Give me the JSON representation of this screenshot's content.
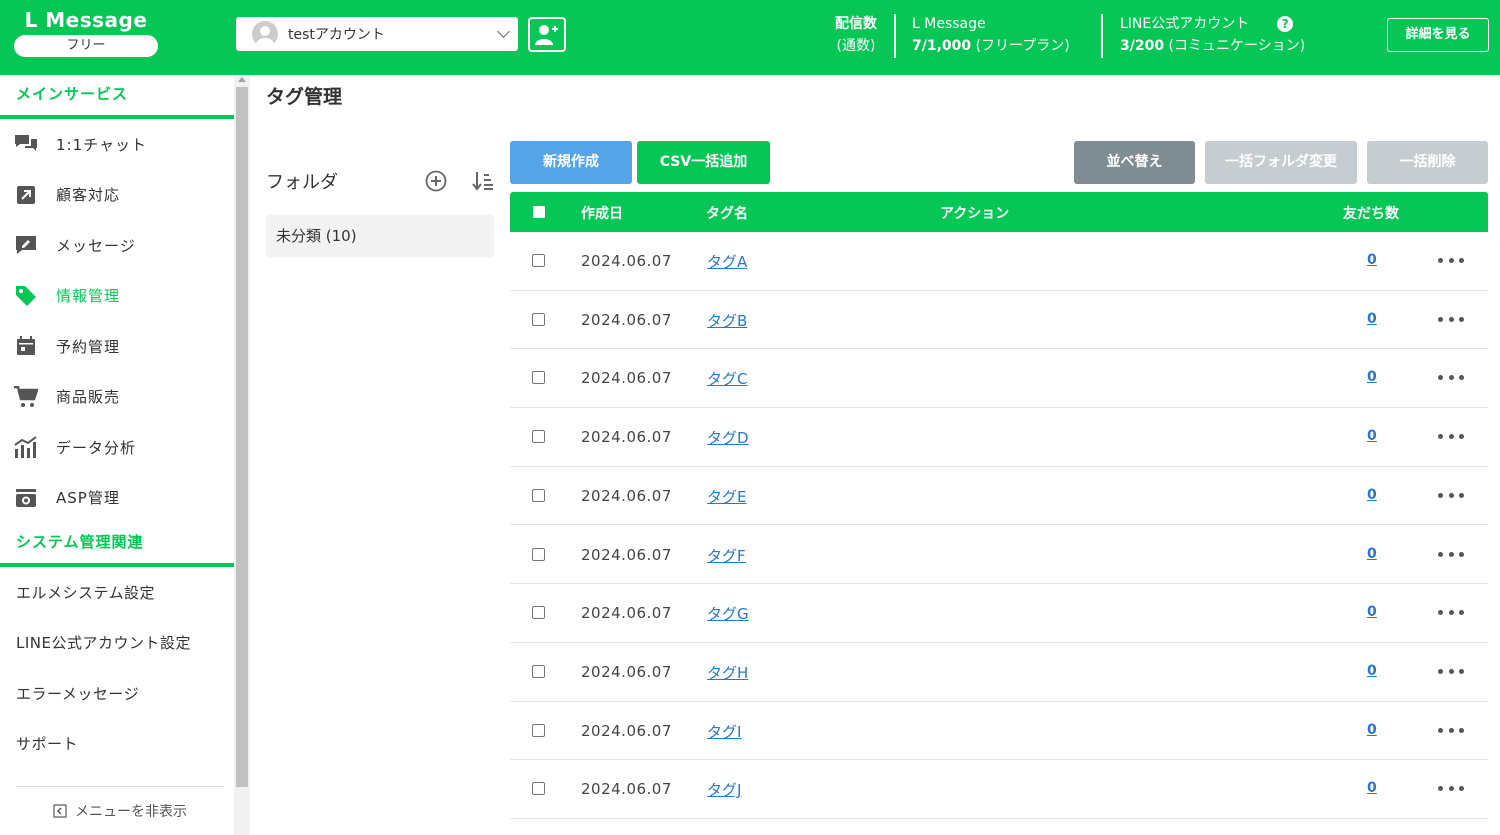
{
  "header": {
    "logo_title": "L Message",
    "plan_badge": "フリー",
    "account_name": "testアカウント",
    "stats": {
      "delivery_label": "配信数",
      "delivery_sub": "(通数)",
      "lmessage_label": "L Message",
      "lmessage_value": "7/1,000",
      "lmessage_plan": "(フリープラン)",
      "line_label": "LINE公式アカウント",
      "line_value": "3/200",
      "line_plan": "(コミュニケーション)"
    },
    "help_glyph": "?",
    "details_button": "詳細を見る"
  },
  "sidebar": {
    "section_main": "メインサービス",
    "items": [
      {
        "label": "1:1チャット",
        "icon": "chat-icon"
      },
      {
        "label": "顧客対応",
        "icon": "external-link-icon"
      },
      {
        "label": "メッセージ",
        "icon": "message-edit-icon"
      },
      {
        "label": "情報管理",
        "icon": "tag-icon",
        "active": true
      },
      {
        "label": "予約管理",
        "icon": "calendar-icon"
      },
      {
        "label": "商品販売",
        "icon": "cart-icon"
      },
      {
        "label": "データ分析",
        "icon": "chart-icon"
      },
      {
        "label": "ASP管理",
        "icon": "asp-icon"
      }
    ],
    "section_system": "システム管理関連",
    "system_items": [
      "エルメシステム設定",
      "LINE公式アカウント設定",
      "エラーメッセージ",
      "サポート"
    ],
    "hide_menu": "メニューを非表示"
  },
  "main": {
    "page_title": "タグ管理",
    "folder_title": "フォルダ",
    "folder_item": "未分類 (10)",
    "buttons": {
      "new": "新規作成",
      "csv": "CSV一括追加",
      "sort": "並べ替え",
      "bulk_folder": "一括フォルダ変更",
      "bulk_delete": "一括削除"
    },
    "columns": {
      "created": "作成日",
      "tag_name": "タグ名",
      "action": "アクション",
      "friends": "友だち数"
    },
    "rows": [
      {
        "date": "2024.06.07",
        "tag": "タグA",
        "count": "0"
      },
      {
        "date": "2024.06.07",
        "tag": "タグB",
        "count": "0"
      },
      {
        "date": "2024.06.07",
        "tag": "タグC",
        "count": "0"
      },
      {
        "date": "2024.06.07",
        "tag": "タグD",
        "count": "0"
      },
      {
        "date": "2024.06.07",
        "tag": "タグE",
        "count": "0"
      },
      {
        "date": "2024.06.07",
        "tag": "タグF",
        "count": "0"
      },
      {
        "date": "2024.06.07",
        "tag": "タグG",
        "count": "0"
      },
      {
        "date": "2024.06.07",
        "tag": "タグH",
        "count": "0"
      },
      {
        "date": "2024.06.07",
        "tag": "タグI",
        "count": "0"
      },
      {
        "date": "2024.06.07",
        "tag": "タグJ",
        "count": "0"
      }
    ]
  },
  "colors": {
    "brand_green": "#06c755",
    "primary_blue": "#55a4e8",
    "sort_gray": "#7f8d93",
    "disabled_gray": "#c6cdd1",
    "link_blue": "#2a77c9"
  }
}
